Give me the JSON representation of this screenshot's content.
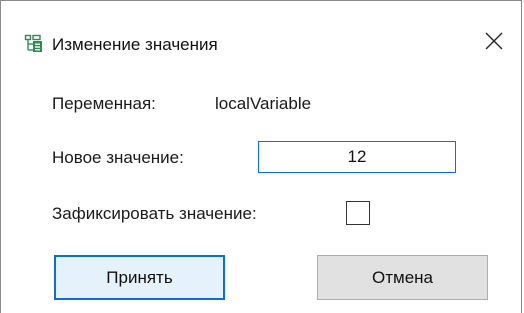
{
  "window": {
    "title": "Изменение значения",
    "app_icon": "variable-edit-icon",
    "close_icon": "close-icon"
  },
  "form": {
    "variable_label": "Переменная:",
    "variable_name": "localVariable",
    "new_value_label": "Новое значение:",
    "new_value": "12",
    "fix_label": "Зафиксировать значение:",
    "fix_checked": false
  },
  "buttons": {
    "accept_label": "Принять",
    "cancel_label": "Отмена"
  },
  "colors": {
    "accent": "#0a6fd8",
    "icon_green": "#2e8b57",
    "button_face": "#e1e1e1",
    "default_button_face": "#e5f1fb"
  }
}
